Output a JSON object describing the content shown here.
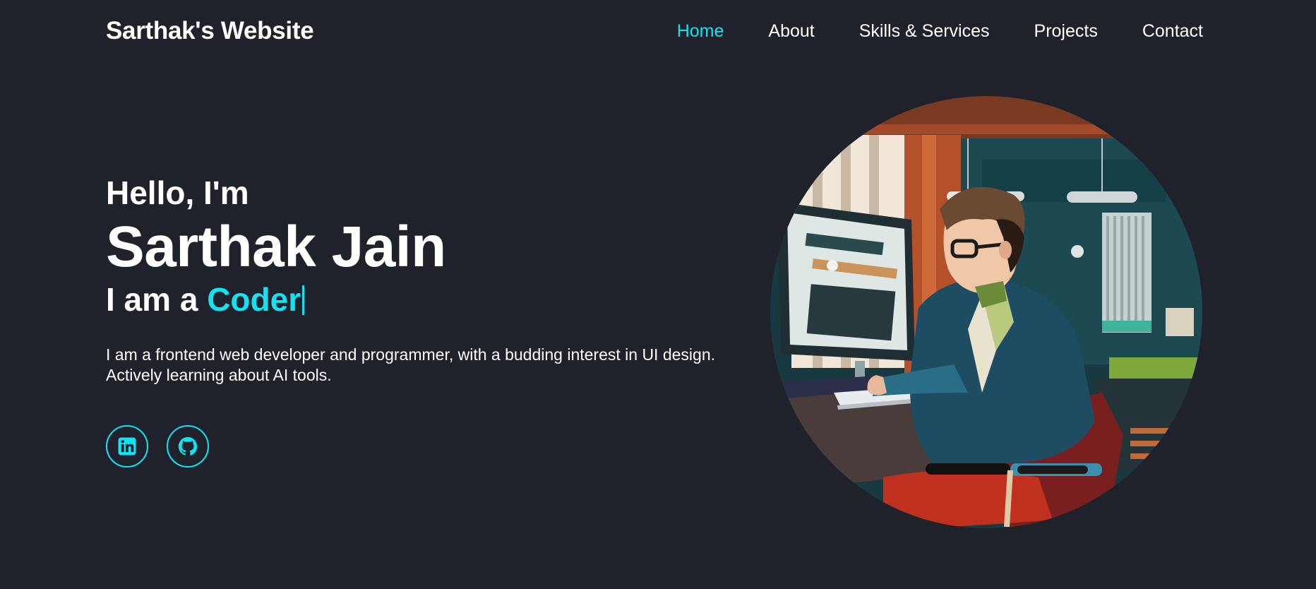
{
  "header": {
    "logo": "Sarthak's Website",
    "nav": [
      {
        "label": "Home",
        "active": true
      },
      {
        "label": "About",
        "active": false
      },
      {
        "label": "Skills & Services",
        "active": false
      },
      {
        "label": "Projects",
        "active": false
      },
      {
        "label": "Contact",
        "active": false
      }
    ]
  },
  "hero": {
    "greeting": "Hello, I'm",
    "name": "Sarthak Jain",
    "role_prefix": "I am a ",
    "role_word": "Coder",
    "description_line1": "I am a frontend web developer and programmer, with a budding interest in UI design.",
    "description_line2": "Actively learning about AI tools."
  },
  "socials": [
    {
      "icon": "linkedin-icon"
    },
    {
      "icon": "github-icon"
    }
  ],
  "colors": {
    "background": "#1f222a",
    "accent": "#12e2f2",
    "text": "#ffffff"
  }
}
